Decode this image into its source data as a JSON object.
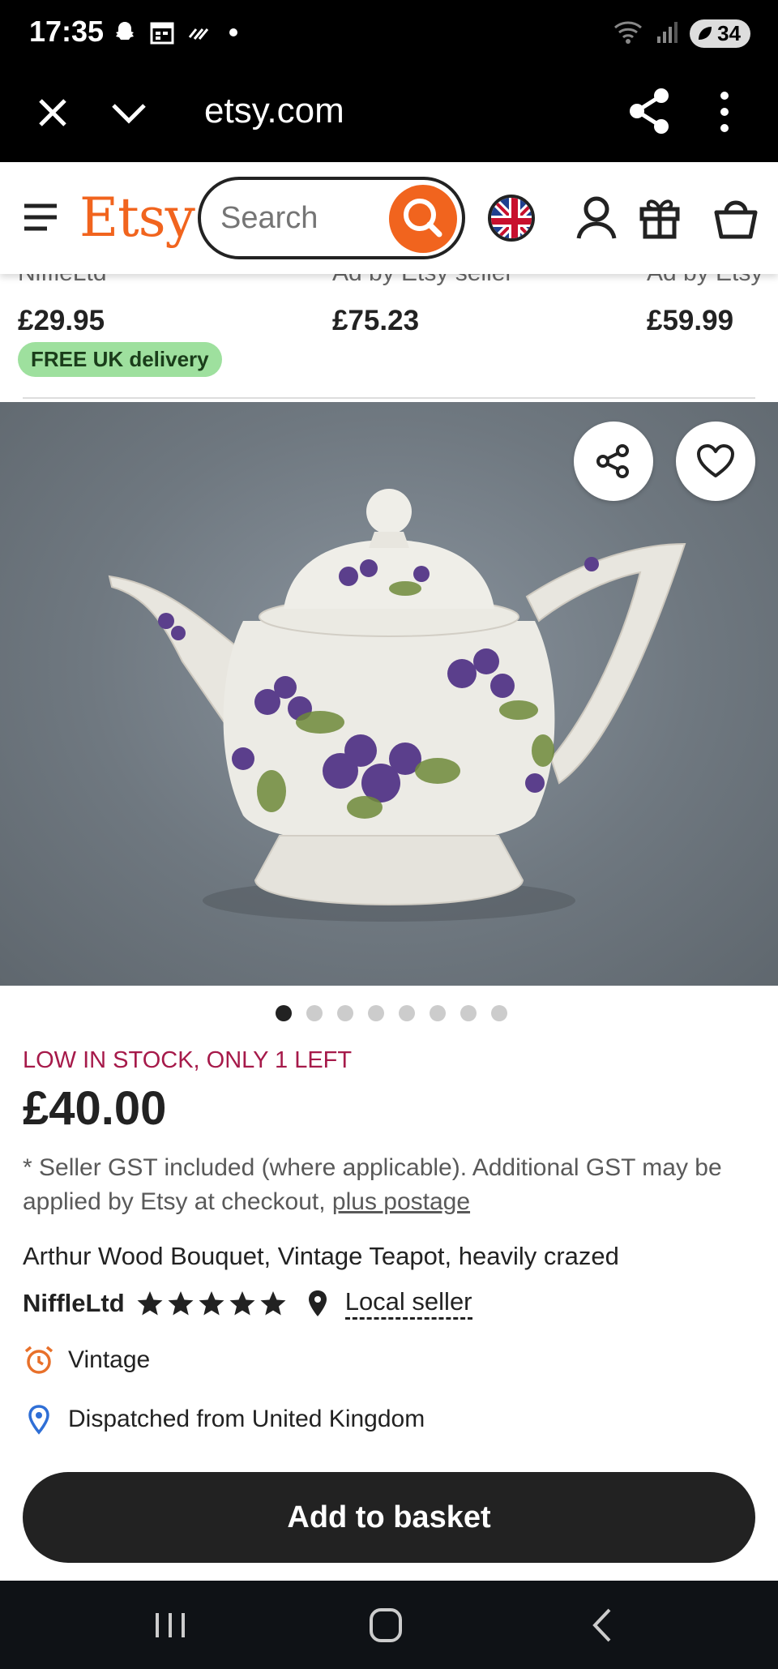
{
  "status_bar": {
    "time": "17:35",
    "battery": "34"
  },
  "browser": {
    "url": "etsy.com"
  },
  "header": {
    "logo": "Etsy",
    "search_placeholder": "Search"
  },
  "recommendations": [
    {
      "cut_text": "NiffleLtd",
      "price": "£29.95",
      "badge": "FREE UK delivery"
    },
    {
      "cut_text": "Ad by Etsy seller",
      "price": "£75.23"
    },
    {
      "cut_text": "Ad by Etsy",
      "price": "£59.99"
    }
  ],
  "image_carousel": {
    "total": 8,
    "active_index": 0
  },
  "product": {
    "stock_notice": "LOW IN STOCK, ONLY 1 LEFT",
    "price": "£40.00",
    "gst_note": "* Seller GST included (where applicable). Additional GST may be applied by Etsy at checkout,",
    "postage_link": "plus postage",
    "title": "Arthur Wood Bouquet, Vintage Teapot, heavily crazed",
    "seller": "NiffleLtd",
    "rating": 5,
    "local_seller_label": "Local seller",
    "features": [
      {
        "icon": "alarm-clock-icon",
        "label": "Vintage"
      },
      {
        "icon": "location-pin-icon",
        "label": "Dispatched from United Kingdom"
      }
    ],
    "add_to_basket": "Add to basket"
  },
  "colors": {
    "etsy_orange": "#f1641e",
    "stock_red": "#a61a4a",
    "badge_green": "#9ee09e",
    "cta_black": "#222222"
  }
}
